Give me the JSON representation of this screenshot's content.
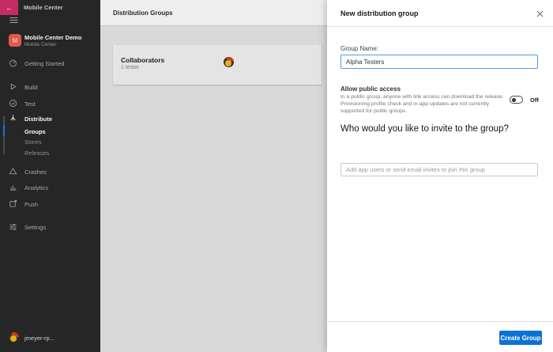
{
  "colors": {
    "brand_pink": "#c52b63",
    "primary_blue": "#0b72d4",
    "focus_blue": "#4a9fe8",
    "sidebar_bg": "#262626",
    "avatar_red": "#c23b22",
    "avatar_yellow": "#e3b40e"
  },
  "sidebar": {
    "top_title": "Mobile Center",
    "app_name": "Mobile Center Demo",
    "app_subtitle": "Mobile Center",
    "app_initial": "M",
    "nav": [
      {
        "label": "Getting Started",
        "icon": "gauge-icon"
      },
      {
        "label": "Build",
        "icon": "build-play-icon"
      },
      {
        "label": "Test",
        "icon": "test-check-icon"
      },
      {
        "label": "Distribute",
        "icon": "distribute-branch-icon"
      },
      {
        "label": "Groups"
      },
      {
        "label": "Stores"
      },
      {
        "label": "Releases"
      },
      {
        "label": "Crashes",
        "icon": "crashes-warning-icon"
      },
      {
        "label": "Analytics",
        "icon": "analytics-bars-icon"
      },
      {
        "label": "Push",
        "icon": "push-notification-icon"
      },
      {
        "label": "Settings",
        "icon": "settings-sliders-icon"
      }
    ],
    "user_name": "jmeyer-rp..."
  },
  "groups_panel": {
    "title": "Distribution Groups",
    "groups": [
      {
        "name": "Collaborators",
        "testers": "1 tester"
      }
    ]
  },
  "dialog": {
    "title": "New distribution group",
    "group_name_label": "Group Name:",
    "group_name_value": "Alpha Testers",
    "public_access_label": "Allow public access",
    "public_access_description": "In a public group, anyone with link access can download the release. Provisioning profile check and in-app updates are not currently supported for public groups.",
    "toggle_state_label": "Off",
    "invite_heading": "Who would you like to invite to the group?",
    "invite_placeholder": "Add app users or send email invites to join this group",
    "create_button_label": "Create Group"
  }
}
